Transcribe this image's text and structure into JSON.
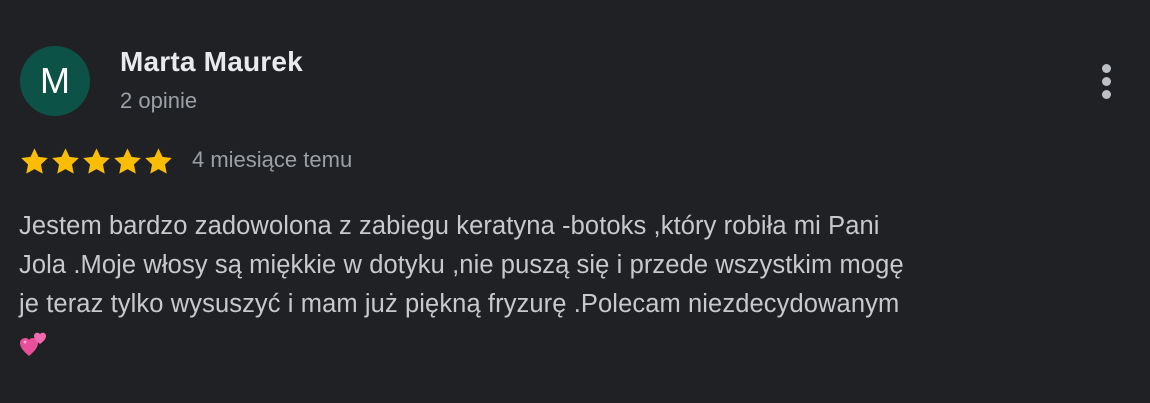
{
  "author": {
    "initial": "M",
    "name": "Marta Maurek",
    "meta": "2 opinie",
    "avatar_color": "#0d5246"
  },
  "rating": {
    "stars": 5,
    "max": 5,
    "star_color": "#fbbc04",
    "date": "4 miesiące temu"
  },
  "menu": {
    "icon": "more-vert-icon"
  },
  "review": {
    "lines": [
      "Jestem bardzo zadowolona z zabiegu keratyna -botoks ,który robiła mi Pani",
      "Jola .Moje włosy są miękkie w dotyku ,nie puszą się i przede wszystkim mogę",
      "je teraz tylko wysuszyć i mam już piękną fryzurę .Polecam niezdecydowanym"
    ],
    "emoji": "two-hearts-icon"
  }
}
